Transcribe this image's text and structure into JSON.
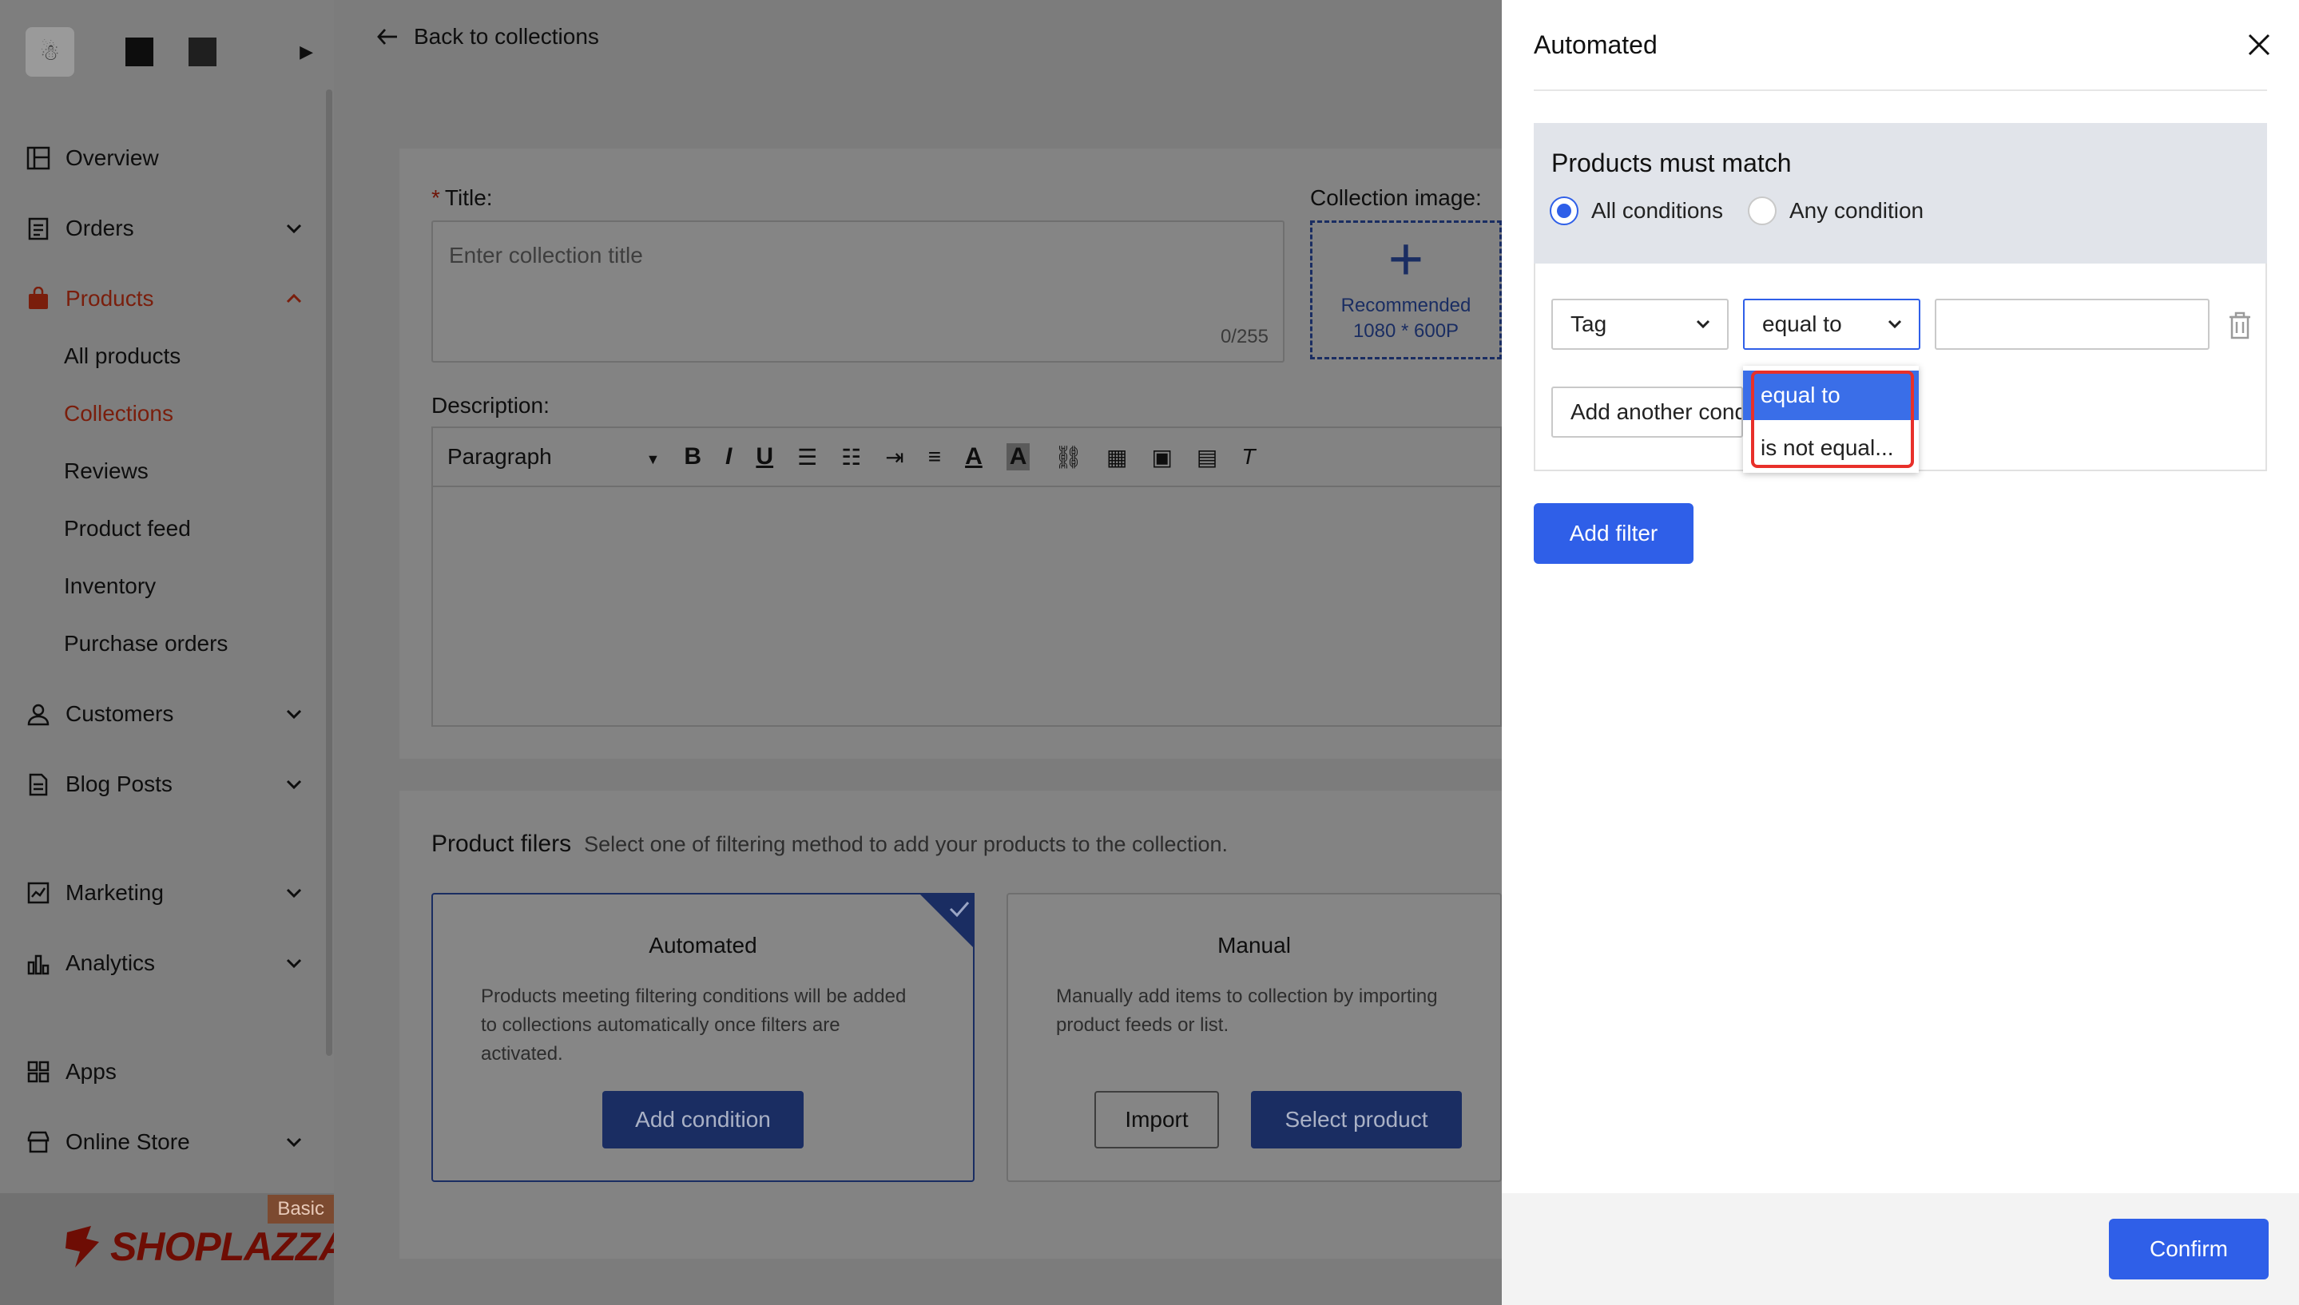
{
  "sidebar": {
    "avatar_glyph": "☃",
    "nav": [
      {
        "label": "Overview",
        "icon": "overview-icon"
      },
      {
        "label": "Orders",
        "icon": "orders-icon"
      },
      {
        "label": "Products",
        "icon": "bag-icon"
      },
      {
        "label": "Customers",
        "icon": "user-icon"
      },
      {
        "label": "Blog Posts",
        "icon": "doc-icon"
      },
      {
        "label": "Marketing",
        "icon": "marketing-icon"
      },
      {
        "label": "Analytics",
        "icon": "chart-icon"
      },
      {
        "label": "Apps",
        "icon": "apps-icon"
      },
      {
        "label": "Online Store",
        "icon": "store-icon"
      }
    ],
    "products_sub": [
      "All products",
      "Collections",
      "Reviews",
      "Product feed",
      "Inventory",
      "Purchase orders"
    ],
    "brand": "SHOPLAZZA",
    "plan_badge": "Basic",
    "active_color": "#7a1e0c"
  },
  "main": {
    "back_label": "Back to collections",
    "title_label": "Title",
    "title_placeholder": "Enter collection title",
    "title_count": "0/255",
    "image_label": "Collection image",
    "image_hint_1": "Recommended",
    "image_hint_2": "1080 * 600P",
    "description_label": "Description",
    "toolbar_paragraph": "Paragraph",
    "filers_title": "Product filers",
    "filers_hint": "Select one of filtering method to add your products to the collection.",
    "automated": {
      "title": "Automated",
      "desc": "Products meeting filtering conditions will be added to collections automatically once filters are activated.",
      "button": "Add condition"
    },
    "manual": {
      "title": "Manual",
      "desc": "Manually add items to collection by importing product feeds or list.",
      "import_button": "Import",
      "select_button": "Select product"
    }
  },
  "drawer": {
    "title": "Automated",
    "match_heading": "Products must match",
    "radio_all": "All conditions",
    "radio_any": "Any condition",
    "field_select": "Tag",
    "operator_select": "equal to",
    "value_input": "",
    "add_another": "Add another condition",
    "dropdown_options": [
      "equal to",
      "is not equal..."
    ],
    "add_filter": "Add filter",
    "confirm": "Confirm",
    "accent_color": "#2f5fe8",
    "highlight_color": "#e8302a"
  }
}
